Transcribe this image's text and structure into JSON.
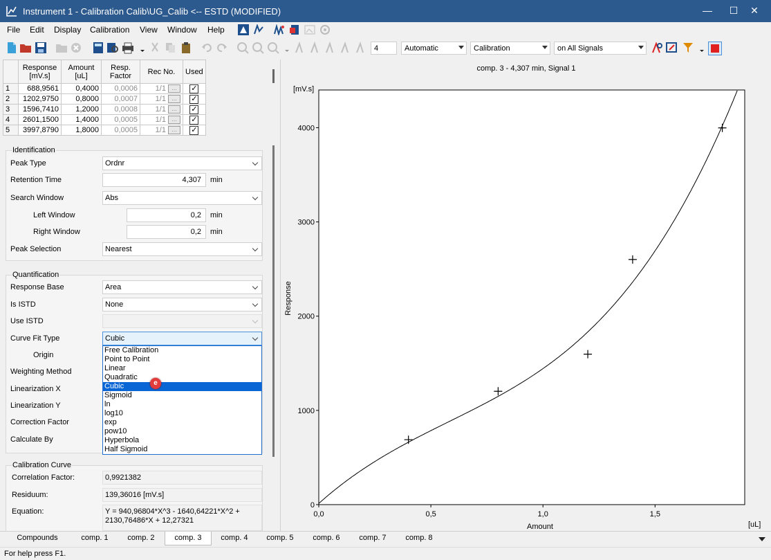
{
  "window": {
    "title": "Instrument 1 - Calibration Calib\\UG_Calib <-- ESTD (MODIFIED)",
    "minimize": "—",
    "maximize": "☐",
    "close": "✕"
  },
  "menu": [
    {
      "label": "File"
    },
    {
      "label": "Edit"
    },
    {
      "label": "Display"
    },
    {
      "label": "Calibration"
    },
    {
      "label": "View"
    },
    {
      "label": "Window"
    },
    {
      "label": "Help"
    }
  ],
  "toolbar": {
    "level_value": "4",
    "mode_value": "Automatic",
    "type_value": "Calibration",
    "signals_value": "on All Signals"
  },
  "calib_table": {
    "headers": [
      "Response\n[mV.s]",
      "Amount\n[uL]",
      "Resp.\nFactor",
      "Rec No.",
      "Used"
    ],
    "rows": [
      {
        "no": "1",
        "response": "688,9561",
        "amount": "0,4000",
        "factor": "0,0006",
        "rec": "1/1"
      },
      {
        "no": "2",
        "response": "1202,9750",
        "amount": "0,8000",
        "factor": "0,0007",
        "rec": "1/1"
      },
      {
        "no": "3",
        "response": "1596,7410",
        "amount": "1,2000",
        "factor": "0,0008",
        "rec": "1/1"
      },
      {
        "no": "4",
        "response": "2601,1500",
        "amount": "1,4000",
        "factor": "0,0005",
        "rec": "1/1"
      },
      {
        "no": "5",
        "response": "3997,8790",
        "amount": "1,8000",
        "factor": "0,0005",
        "rec": "1/1"
      }
    ],
    "dots": "...",
    "check": "✓"
  },
  "identification": {
    "title": "Identification",
    "peak_type_label": "Peak Type",
    "peak_type": "Ordnr",
    "retention_label": "Retention Time",
    "retention": "4,307",
    "retention_unit": "min",
    "search_label": "Search Window",
    "search": "Abs",
    "left_label": "Left Window",
    "left": "0,2",
    "left_unit": "min",
    "right_label": "Right Window",
    "right": "0,2",
    "right_unit": "min",
    "peak_sel_label": "Peak Selection",
    "peak_sel": "Nearest"
  },
  "quantification": {
    "title": "Quantification",
    "resp_base_label": "Response Base",
    "resp_base": "Area",
    "istd_label": "Is ISTD",
    "istd": "None",
    "use_istd_label": "Use ISTD",
    "use_istd": "",
    "curve_fit_label": "Curve Fit Type",
    "curve_fit": "Cubic",
    "origin_label": "Origin",
    "weighting_label": "Weighting Method",
    "lin_x_label": "Linearization X",
    "lin_y_label": "Linearization Y",
    "corr_label": "Correction Factor",
    "calc_label": "Calculate By",
    "options": [
      "Free Calibration",
      "Point to Point",
      "Linear",
      "Quadratic",
      "Cubic",
      "Sigmoid",
      "ln",
      "log10",
      "exp",
      "pow10",
      "Hyperbola",
      "Half Sigmoid"
    ],
    "selected_index": 4,
    "badge": "e"
  },
  "curve": {
    "title": "Calibration Curve",
    "corr_label": "Correlation Factor:",
    "corr": "0,9921382",
    "resid_label": "Residuum:",
    "resid": "139,36016 [mV.s]",
    "eq_label": "Equation:",
    "eq": "Y = 940,96804*X^3 - 1640,64221*X^2 + 2130,76486*X + 12,27321"
  },
  "chart_data": {
    "type": "scatter",
    "title": "comp. 3 - 4,307 min, Signal 1",
    "xlabel": "Amount",
    "ylabel": "Response",
    "x_unit": "[uL]",
    "y_unit": "[mV.s]",
    "xlim": [
      0,
      1.9
    ],
    "ylim": [
      0,
      4400
    ],
    "x_ticks": [
      {
        "v": 0,
        "t": "0,0"
      },
      {
        "v": 0.5,
        "t": "0,5"
      },
      {
        "v": 1.0,
        "t": "1,0"
      },
      {
        "v": 1.5,
        "t": "1,5"
      }
    ],
    "y_ticks": [
      {
        "v": 0,
        "t": "0"
      },
      {
        "v": 1000,
        "t": "1000"
      },
      {
        "v": 2000,
        "t": "2000"
      },
      {
        "v": 3000,
        "t": "3000"
      },
      {
        "v": 4000,
        "t": "4000"
      }
    ],
    "points": [
      {
        "x": 0.4,
        "y": 688.9561
      },
      {
        "x": 0.8,
        "y": 1202.975
      },
      {
        "x": 1.2,
        "y": 1596.741
      },
      {
        "x": 1.4,
        "y": 2601.15
      },
      {
        "x": 1.8,
        "y": 3997.879
      }
    ],
    "fit": {
      "a3": 940.96804,
      "a2": -1640.64221,
      "a1": 2130.76486,
      "a0": 12.27321
    }
  },
  "tabs": [
    {
      "label": "Compounds"
    },
    {
      "label": "comp. 1"
    },
    {
      "label": "comp. 2"
    },
    {
      "label": "comp. 3",
      "active": true
    },
    {
      "label": "comp. 4"
    },
    {
      "label": "comp. 5"
    },
    {
      "label": "comp. 6"
    },
    {
      "label": "comp. 7"
    },
    {
      "label": "comp. 8"
    }
  ],
  "status": "For help press F1.",
  "colors": {
    "titlebar": "#2d5a8e",
    "selection": "#0a66d4",
    "record": "#e01f1f"
  }
}
